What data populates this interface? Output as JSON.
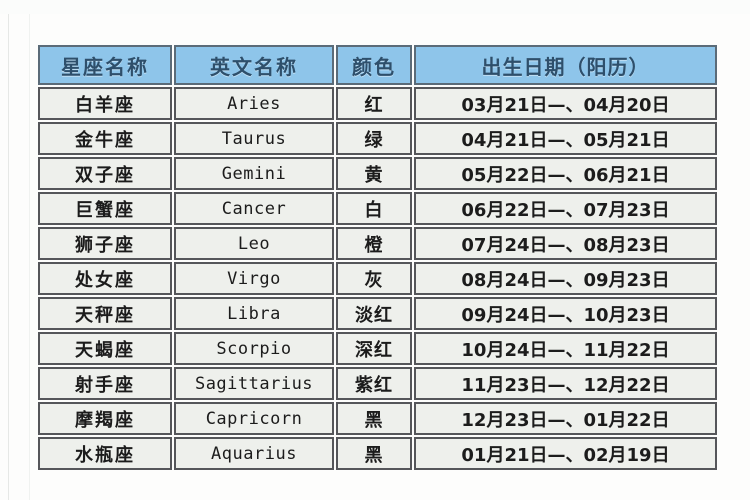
{
  "top_strip": {
    "ghost_text": "•••••   ••   •••••"
  },
  "colors": {
    "header_fill": "#8ec5ea",
    "header_border": "#5b6b78",
    "header_text": "#2e4f6b",
    "row_fill": "#eef0ec",
    "row_border": "#55565a",
    "row_text": "#1c1c1c",
    "page_bg": "#fdfdfc"
  },
  "table": {
    "name": "zodiac-table",
    "headers": [
      "星座名称",
      "英文名称",
      "颜色",
      "出生日期（阳历）"
    ],
    "rows": [
      {
        "name": "白羊座",
        "english": "Aries",
        "color": "红",
        "date": "03月21日—、04月20日"
      },
      {
        "name": "金牛座",
        "english": "Taurus",
        "color": "绿",
        "date": "04月21日—、05月21日"
      },
      {
        "name": "双子座",
        "english": "Gemini",
        "color": "黄",
        "date": "05月22日—、06月21日"
      },
      {
        "name": "巨蟹座",
        "english": "Cancer",
        "color": "白",
        "date": "06月22日—、07月23日"
      },
      {
        "name": "狮子座",
        "english": "Leo",
        "color": "橙",
        "date": "07月24日—、08月23日"
      },
      {
        "name": "处女座",
        "english": "Virgo",
        "color": "灰",
        "date": "08月24日—、09月23日"
      },
      {
        "name": "天秤座",
        "english": "Libra",
        "color": "淡红",
        "date": "09月24日—、10月23日"
      },
      {
        "name": "天蝎座",
        "english": "Scorpio",
        "color": "深红",
        "date": "10月24日—、11月22日"
      },
      {
        "name": "射手座",
        "english": "Sagittarius",
        "color": "紫红",
        "date": "11月23日—、12月22日"
      },
      {
        "name": "摩羯座",
        "english": "Capricorn",
        "color": "黑",
        "date": "12月23日—、01月22日"
      },
      {
        "name": "水瓶座",
        "english": "Aquarius",
        "color": "黑",
        "date": "01月21日—、02月19日"
      }
    ]
  }
}
